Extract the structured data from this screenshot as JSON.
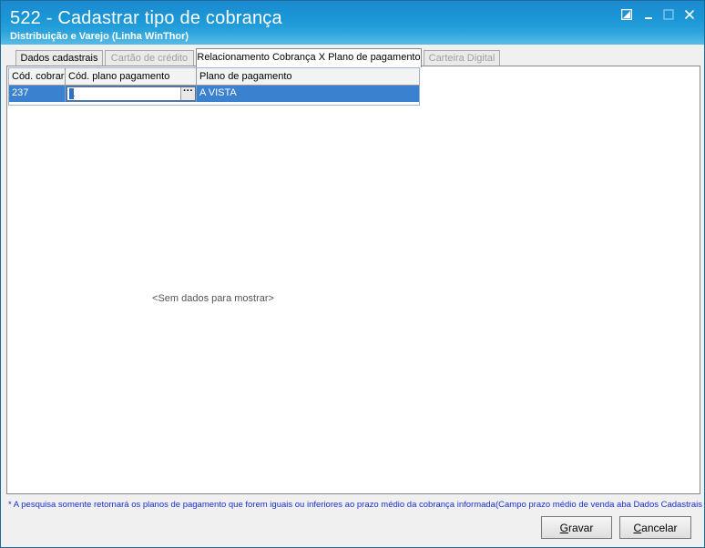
{
  "window": {
    "title": "522 - Cadastrar tipo de cobrança",
    "subtitle": "Distribuição e Varejo (Linha WinThor)"
  },
  "tabs": [
    {
      "label": "Dados cadastrais",
      "state": "normal"
    },
    {
      "label": "Cartão de crédito",
      "state": "disabled"
    },
    {
      "label": "Relacionamento Cobrança X Plano de pagamento",
      "state": "active"
    },
    {
      "label": "Carteira Digital",
      "state": "disabled"
    }
  ],
  "grid": {
    "columns": [
      "Cód. cobrar",
      "Cód. plano pagamento",
      "Plano de pagamento"
    ],
    "rows": [
      {
        "cod_cobrar": "237",
        "cod_plano": "1",
        "plano": "A VISTA"
      }
    ],
    "ellipsis": "···"
  },
  "empty_message": "<Sem dados para mostrar>",
  "footnote": "* A pesquisa somente retornará os planos de pagamento que forem iguais ou inferiores ao prazo médio da cobrança informada(Campo prazo médio de venda aba Dados Cadastrais)",
  "buttons": {
    "save": {
      "hotkey": "G",
      "rest": "ravar"
    },
    "cancel": {
      "hotkey": "C",
      "rest": "ancelar"
    }
  },
  "colors": {
    "titlebar": "#1a96d6",
    "selection": "#3a82d0",
    "footnote": "#1a2fd0"
  }
}
